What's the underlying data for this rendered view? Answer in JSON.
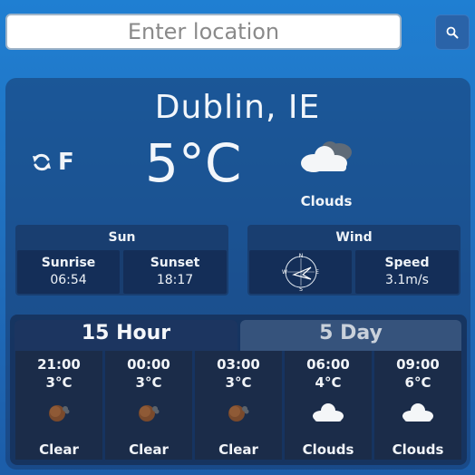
{
  "search": {
    "placeholder": "Enter location"
  },
  "current": {
    "city": "Dublin, IE",
    "unit_toggle": "F",
    "temperature": "5°C",
    "condition": "Clouds"
  },
  "sun": {
    "title": "Sun",
    "sunrise_label": "Sunrise",
    "sunrise": "06:54",
    "sunset_label": "Sunset",
    "sunset": "18:17"
  },
  "wind": {
    "title": "Wind",
    "compass": {
      "n": "N",
      "e": "E",
      "s": "S",
      "w": "W"
    },
    "speed_label": "Speed",
    "speed": "3.1m/s"
  },
  "forecast": {
    "tabs": [
      "15 Hour",
      "5 Day"
    ],
    "active_tab": "15 Hour",
    "hours": [
      {
        "time": "21:00",
        "temp": "3°C",
        "icon": "moon-icon",
        "condition": "Clear"
      },
      {
        "time": "00:00",
        "temp": "3°C",
        "icon": "moon-icon",
        "condition": "Clear"
      },
      {
        "time": "03:00",
        "temp": "3°C",
        "icon": "moon-icon",
        "condition": "Clear"
      },
      {
        "time": "06:00",
        "temp": "4°C",
        "icon": "cloud-icon",
        "condition": "Clouds"
      },
      {
        "time": "09:00",
        "temp": "6°C",
        "icon": "cloud-icon",
        "condition": "Clouds"
      }
    ]
  },
  "colors": {
    "background": "#1f7fd2",
    "card": "#183a6e",
    "tile": "#1b2c49"
  }
}
